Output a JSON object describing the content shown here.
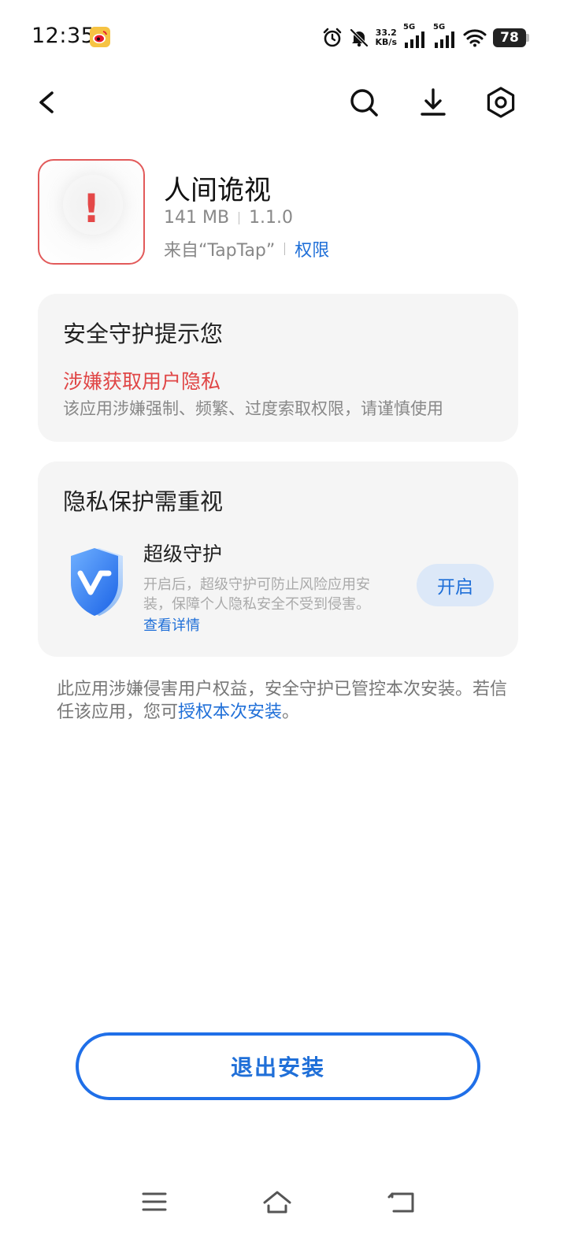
{
  "status_bar": {
    "time": "12:35",
    "net_speed_value": "33.2",
    "net_speed_unit": "KB/s",
    "sim1_label": "5G",
    "sim2_label": "5G",
    "battery": "78"
  },
  "app": {
    "name": "人间诡视",
    "size": "141 MB",
    "version": "1.1.0",
    "source": "来自“TapTap”",
    "permission_link": "权限"
  },
  "security_card": {
    "title": "安全守护提示您",
    "risk_title": "涉嫌获取用户隐私",
    "risk_desc": "该应用涉嫌强制、频繁、过度索取权限，请谨慎使用"
  },
  "privacy_card": {
    "title": "隐私保护需重视",
    "feature_title": "超级守护",
    "feature_desc": "开启后，超级守护可防止风险应用安装，保障个人隐私安全不受到侵害。",
    "detail_link": "查看详情",
    "enable_label": "开启"
  },
  "notice": {
    "text_before": "此应用涉嫌侵害用户权益，安全守护已管控本次安装。若信任该应用，您可",
    "link": "授权本次安装",
    "text_after": "。"
  },
  "exit_button": "退出安装",
  "colors": {
    "accent": "#1f6fd8",
    "danger": "#e04646",
    "card_bg": "#f5f5f5"
  }
}
